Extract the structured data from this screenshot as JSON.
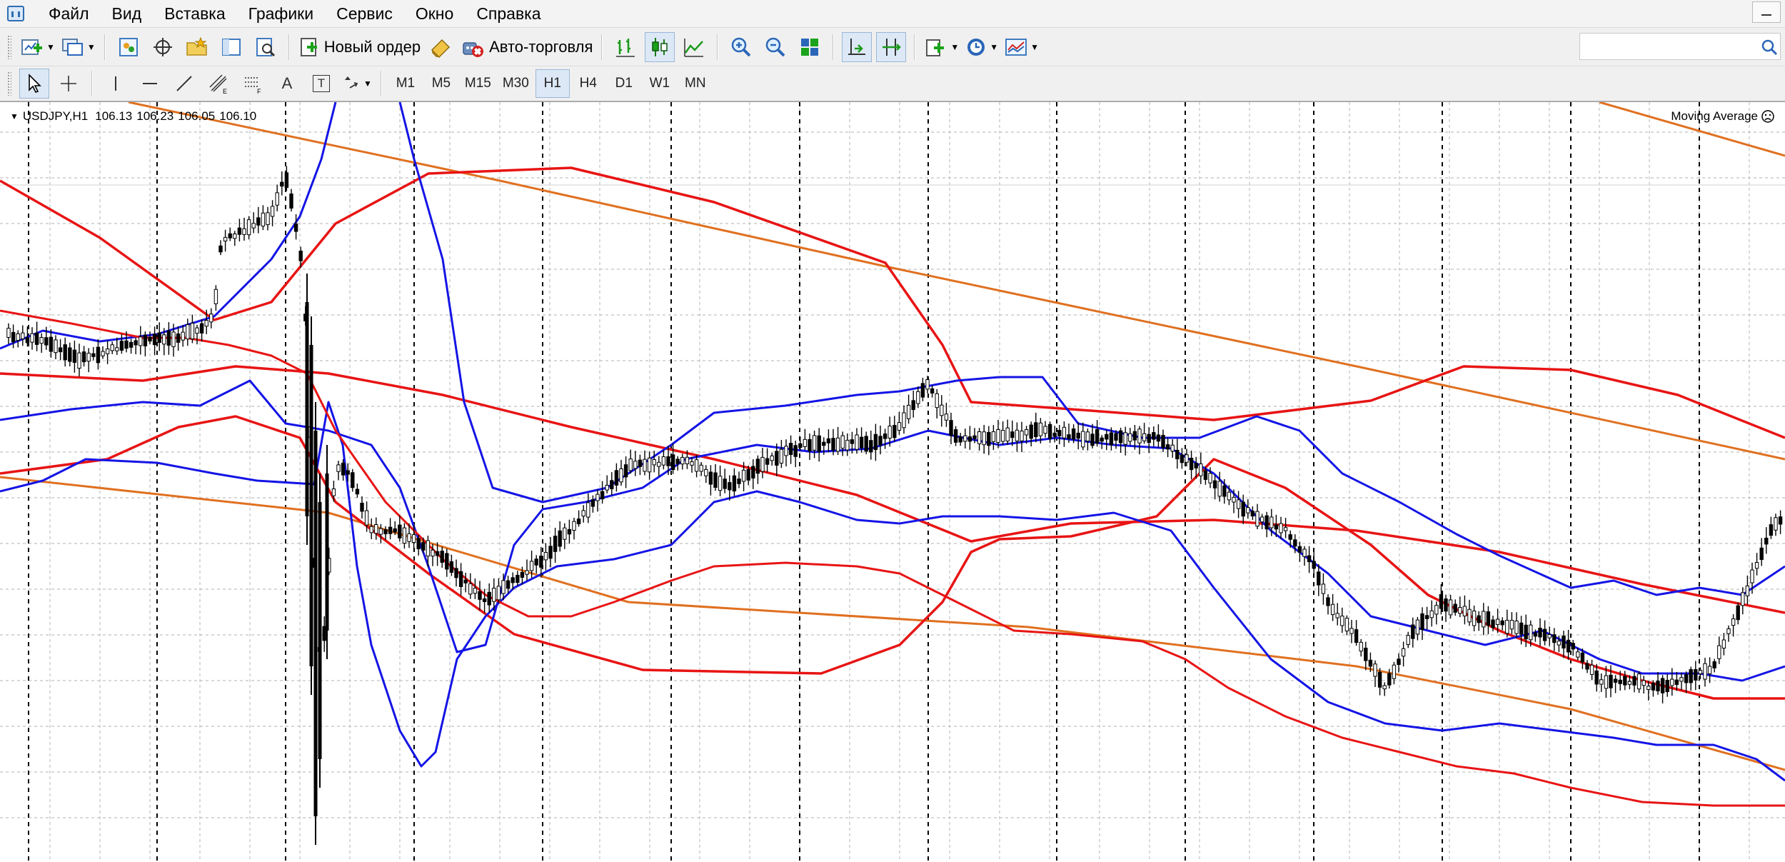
{
  "menu": {
    "items": [
      "Файл",
      "Вид",
      "Вставка",
      "Графики",
      "Сервис",
      "Окно",
      "Справка"
    ]
  },
  "toolbar": {
    "new_order_label": "Новый ордер",
    "auto_trading_label": "Авто-торговля",
    "search_placeholder": ""
  },
  "timeframes": [
    "M1",
    "M5",
    "M15",
    "M30",
    "H1",
    "H4",
    "D1",
    "W1",
    "MN"
  ],
  "active_timeframe": "H1",
  "tools": {
    "text_tool": "A",
    "text_label_tool": "T"
  },
  "chart": {
    "symbol": "USDJPY,H1",
    "open": "106.13",
    "high": "106.23",
    "low": "106.05",
    "close": "106.10",
    "indicator_label": "Moving Average",
    "colors": {
      "background": "#ffffff",
      "grid": "#c0c0c0",
      "candle": "#000000",
      "bollinger_fast": "#1414e6",
      "bollinger_slow": "#e81414",
      "envelope": "#e07020",
      "period_separator": "#000000"
    }
  },
  "chart_data": {
    "type": "candlestick",
    "symbol": "USDJPY",
    "timeframe": "H1",
    "last_bar": {
      "open": 106.13,
      "high": 106.23,
      "low": 106.05,
      "close": 106.1
    },
    "indicators": [
      "Moving Average",
      "Bollinger Bands",
      "Bollinger Bands",
      "Envelopes"
    ],
    "period_separators": true,
    "grid": true
  }
}
